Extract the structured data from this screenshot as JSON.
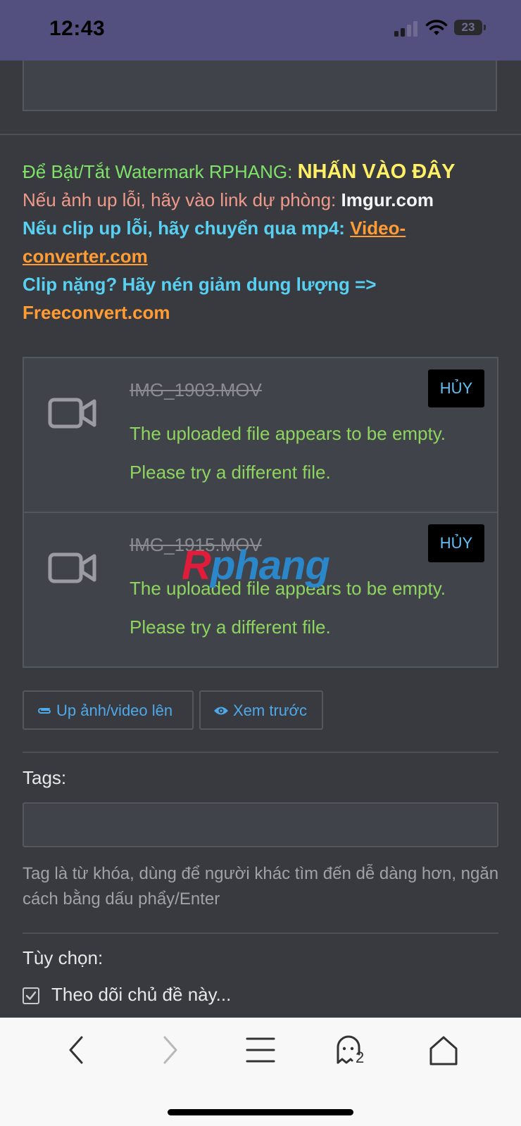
{
  "status_bar": {
    "time": "12:43",
    "battery_level": "23"
  },
  "info": {
    "watermark_prefix": "Để Bật/Tắt Watermark RPHANG: ",
    "watermark_link": "NHẤN VÀO ĐÂY",
    "image_error_prefix": "Nếu ảnh up lỗi, hãy vào link dự phòng: ",
    "image_error_link": "Imgur.com",
    "clip_error_prefix": "Nếu clip up lỗi, hãy chuyển qua mp4: ",
    "clip_error_link": "Video-converter.com",
    "compress_prefix": "Clip nặng? Hãy nén giảm dung lượng => ",
    "compress_link": "Freeconvert.com"
  },
  "attachments": [
    {
      "filename": "IMG_1903.MOV",
      "error_line1": "The uploaded file appears to be empty.",
      "error_line2": "Please try a different file.",
      "cancel_label": "HỦY"
    },
    {
      "filename": "IMG_1915.MOV",
      "error_line1": "The uploaded file appears to be empty.",
      "error_line2": "Please try a different file.",
      "cancel_label": "HỦY"
    }
  ],
  "watermark_logo": "Rphang",
  "buttons": {
    "upload_label": "Up ảnh/video lên",
    "preview_label": "Xem trước"
  },
  "tags": {
    "label": "Tags:",
    "value": "",
    "hint": "Tag là từ khóa, dùng để người khác tìm đến dễ dàng hơn, ngăn cách bằng dấu phẩy/Enter"
  },
  "options": {
    "label": "Tùy chọn:",
    "watch_thread_label": "Theo dõi chủ đề này...",
    "watch_thread_checked": true
  },
  "browser_toolbar": {
    "tabs_count": "2"
  },
  "colors": {
    "statusbar_bg": "#53507f",
    "page_bg": "#393a3f",
    "panel_bg": "#41434a",
    "link_blue": "#4ea9ea",
    "error_green": "#8ed55f"
  },
  "icons": [
    "back-arrow-icon",
    "forward-arrow-icon",
    "menu-icon",
    "tabs-ghost-icon",
    "home-icon",
    "video-camera-icon",
    "paperclip-icon",
    "eye-icon",
    "checkbox-checked-icon"
  ]
}
